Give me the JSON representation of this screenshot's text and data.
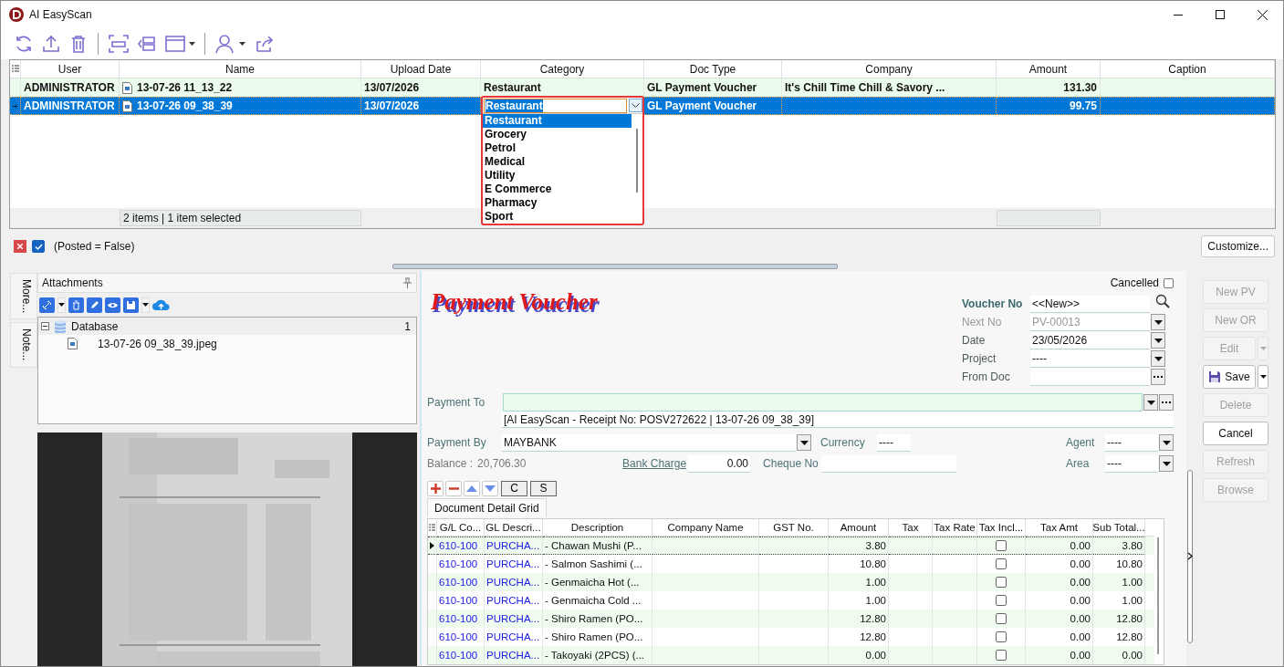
{
  "window": {
    "title": "AI EasyScan"
  },
  "records": {
    "columns": [
      "User",
      "Name",
      "Upload Date",
      "Category",
      "Doc Type",
      "Company",
      "Amount",
      "Caption"
    ],
    "rows": [
      {
        "selected": false,
        "user": "ADMINISTRATOR",
        "name": "13-07-26 11_13_22",
        "upload_date": "13/07/2026",
        "category": "Restaurant",
        "doc_type": "GL Payment Voucher",
        "company": "It's Chill Time Chill & Savory ...",
        "amount": "131.30"
      },
      {
        "selected": true,
        "user": "ADMINISTRATOR",
        "name": "13-07-26 09_38_39",
        "upload_date": "13/07/2026",
        "doc_type": "GL Payment Voucher",
        "amount": "99.75",
        "category_editor": {
          "value": "Restaurant",
          "options": [
            {
              "label": "Restaurant",
              "selected": true
            },
            {
              "label": "Grocery",
              "selected": false
            },
            {
              "label": "Petrol",
              "selected": false
            },
            {
              "label": "Medical",
              "selected": false
            },
            {
              "label": "Utility",
              "selected": false
            },
            {
              "label": "E Commerce",
              "selected": false
            },
            {
              "label": "Pharmacy",
              "selected": false
            },
            {
              "label": "Sport",
              "selected": false
            }
          ]
        }
      }
    ],
    "status": "2 items |  1 item selected"
  },
  "filter": {
    "active": true,
    "text": "(Posted = False)"
  },
  "customize_button": "Customize...",
  "side_tabs": [
    "More...",
    "Note..."
  ],
  "attachments": {
    "title": "Attachments",
    "tree": [
      {
        "label": "Database",
        "count": "1",
        "expanded": true,
        "children": [
          {
            "label": "13-07-26 09_38_39.jpeg"
          }
        ]
      }
    ]
  },
  "voucher": {
    "title": "Payment Voucher",
    "cancelled": {
      "label": "Cancelled",
      "checked": false
    },
    "fields": [
      {
        "kind": "key",
        "label": "Voucher No",
        "value": "<<New>>",
        "disabled": false
      },
      {
        "kind": "dropdown",
        "label": "Next No",
        "value": "PV-00013",
        "disabled": true
      },
      {
        "kind": "dropdown",
        "label": "Date",
        "value": "23/05/2026",
        "disabled": false
      },
      {
        "kind": "dropdown",
        "label": "Project",
        "value": "----",
        "disabled": false
      },
      {
        "kind": "lookup",
        "label": "From Doc",
        "disabled": false
      }
    ],
    "payment_to": {
      "label": "Payment To",
      "note": "[AI EasyScan - Receipt No: POSV272622 | 13-07-26 09_38_39]"
    },
    "payment_by": {
      "label": "Payment By",
      "value": "MAYBANK"
    },
    "currency": {
      "label": "Currency",
      "value": "----"
    },
    "agent": {
      "label": "Agent",
      "value": "----"
    },
    "balance": {
      "label": "Balance :",
      "value": "20,706.30"
    },
    "bank_charge": {
      "label": "Bank Charge",
      "value": "0.00"
    },
    "cheque_no": {
      "label": "Cheque No"
    },
    "area": {
      "label": "Area",
      "value": "----"
    },
    "row_buttons": [
      "C",
      "S"
    ],
    "tab": "Document Detail Grid"
  },
  "detail_grid": {
    "columns": [
      "G/L Co...",
      "GL Descri...",
      "Description",
      "Company Name",
      "GST No.",
      "Amount",
      "Tax",
      "Tax Rate",
      "Tax Incl...",
      "Tax Amt",
      "Sub Total..."
    ],
    "rows": [
      {
        "selected": true,
        "gl_code": "610-100",
        "gl_desc": "PURCHA...",
        "description": "- Chawan Mushi (P...",
        "amount": "3.80",
        "tax_incl": false,
        "tax_amt": "0.00",
        "sub_total": "3.80"
      },
      {
        "selected": false,
        "gl_code": "610-100",
        "gl_desc": "PURCHA...",
        "description": "- Salmon Sashimi (...",
        "amount": "10.80",
        "tax_incl": false,
        "tax_amt": "0.00",
        "sub_total": "10.80"
      },
      {
        "selected": false,
        "gl_code": "610-100",
        "gl_desc": "PURCHA...",
        "description": "- Genmaicha Hot (...",
        "amount": "1.00",
        "tax_incl": false,
        "tax_amt": "0.00",
        "sub_total": "1.00"
      },
      {
        "selected": false,
        "gl_code": "610-100",
        "gl_desc": "PURCHA...",
        "description": "- Genmaicha Cold ...",
        "amount": "1.00",
        "tax_incl": false,
        "tax_amt": "0.00",
        "sub_total": "1.00"
      },
      {
        "selected": false,
        "gl_code": "610-100",
        "gl_desc": "PURCHA...",
        "description": "- Shiro Ramen (PO...",
        "amount": "12.80",
        "tax_incl": false,
        "tax_amt": "0.00",
        "sub_total": "12.80"
      },
      {
        "selected": false,
        "gl_code": "610-100",
        "gl_desc": "PURCHA...",
        "description": "- Shiro Ramen (PO...",
        "amount": "12.80",
        "tax_incl": false,
        "tax_amt": "0.00",
        "sub_total": "12.80"
      },
      {
        "selected": false,
        "gl_code": "610-100",
        "gl_desc": "PURCHA...",
        "description": "- Takoyaki (2PCS) (...",
        "amount": "0.00",
        "tax_incl": false,
        "tax_amt": "0.00",
        "sub_total": "0.00"
      }
    ]
  },
  "actions": [
    {
      "label": "New PV",
      "kind": "plain",
      "disabled": true
    },
    {
      "label": "New OR",
      "kind": "plain",
      "disabled": true
    },
    {
      "label": "Edit",
      "kind": "split",
      "disabled": true
    },
    {
      "label": "Save",
      "kind": "save",
      "disabled": false
    },
    {
      "label": "Delete",
      "kind": "plain",
      "disabled": true
    },
    {
      "label": "Cancel",
      "kind": "plain",
      "disabled": false
    },
    {
      "label": "Refresh",
      "kind": "plain",
      "disabled": true
    },
    {
      "label": "Browse",
      "kind": "plain",
      "disabled": true
    }
  ]
}
